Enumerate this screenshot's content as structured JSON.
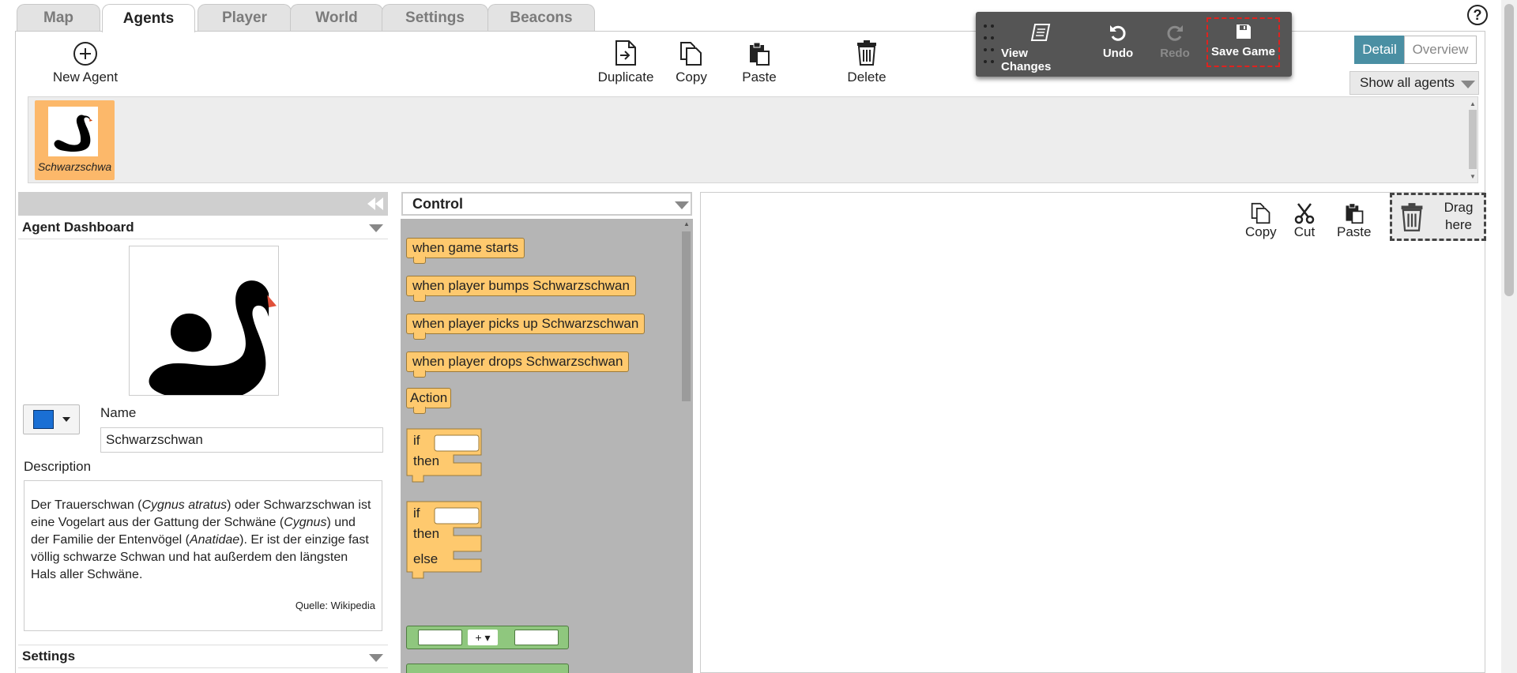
{
  "tabs": [
    "Map",
    "Agents",
    "Player",
    "World",
    "Settings",
    "Beacons"
  ],
  "active_tab": "Agents",
  "toolbar": {
    "new_agent": "New Agent",
    "duplicate": "Duplicate",
    "copy": "Copy",
    "paste": "Paste",
    "delete": "Delete"
  },
  "floating_bar": {
    "view_changes": "View Changes",
    "undo": "Undo",
    "redo": "Redo",
    "save_game": "Save Game"
  },
  "view_toggle": {
    "detail": "Detail",
    "overview": "Overview"
  },
  "agent_filter": "Show all agents",
  "agents": [
    {
      "name": "Schwarzschwa",
      "selected": true
    }
  ],
  "dashboard": {
    "title": "Agent Dashboard",
    "name_label": "Name",
    "name_value": "Schwarzschwan",
    "description_label": "Description",
    "description": {
      "p1": "Der Trauerschwan (",
      "i1": "Cygnus atratus",
      "p2": ") oder Schwarzschwan ist eine Vogelart aus der Gattung der Schwäne (",
      "i2": "Cygnus",
      "p3": ") und der Familie der Entenvögel (",
      "i3": "Anatidae",
      "p4": "). Er ist der einzige fast völlig schwarze Schwan und hat außerdem den längsten Hals aller Schwäne."
    },
    "source": "Quelle: Wikipedia",
    "settings": "Settings"
  },
  "palette": {
    "category": "Control",
    "blocks": [
      "when game starts",
      "when player bumps Schwarzschwan",
      "when player picks up Schwarzschwan",
      "when player drops Schwarzschwan",
      "Action"
    ],
    "if_block": {
      "if": "if",
      "then": "then",
      "else": "else"
    },
    "math_op": "+"
  },
  "workspace": {
    "copy": "Copy",
    "cut": "Cut",
    "paste": "Paste",
    "drag_here": "Drag here"
  },
  "colors": {
    "agent_card": "#fcb86a",
    "block": "#fec96e",
    "math_block": "#8fc77e",
    "detail_active": "#4a8fa3",
    "save_highlight": "#e0221e"
  }
}
